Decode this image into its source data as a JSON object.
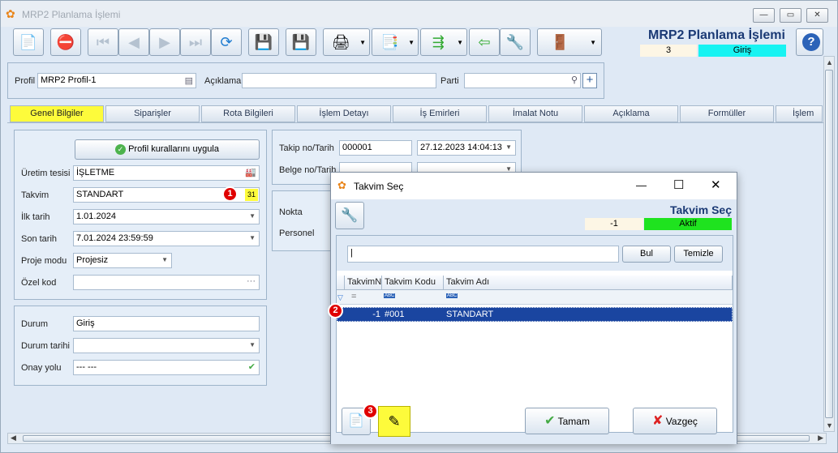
{
  "window": {
    "title": "MRP2 Planlama İşlemi",
    "icon": "butterfly-icon"
  },
  "header": {
    "title": "MRP2 Planlama İşlemi",
    "number": "3",
    "mode": "Giriş",
    "mode_color": "#17f3f2"
  },
  "filter": {
    "profil_label": "Profil",
    "profil_value": "MRP2 Profil-1",
    "aciklama_label": "Açıklama",
    "aciklama_value": "",
    "parti_label": "Parti",
    "parti_value": ""
  },
  "tabs": [
    "Genel Bilgiler",
    "Siparişler",
    "Rota Bilgileri",
    "İşlem Detayı",
    "İş Emirleri",
    "İmalat Notu",
    "Açıklama",
    "Formüller",
    "İşlem G"
  ],
  "left_panel": {
    "apply_button": "Profil kurallarını uygula",
    "uretim_label": "Üretim tesisi",
    "uretim_value": "İŞLETME",
    "takvim_label": "Takvim",
    "takvim_value": "STANDART",
    "ilk_label": "İlk tarih",
    "ilk_value": "1.01.2024",
    "son_label": "Son tarih",
    "son_value": "7.01.2024 23:59:59",
    "proje_label": "Proje modu",
    "proje_value": "Projesiz",
    "ozel_label": "Özel kod",
    "ozel_value": "",
    "ozel_button": "···"
  },
  "status_panel": {
    "durum_label": "Durum",
    "durum_value": "Giriş",
    "durum_tarihi_label": "Durum tarihi",
    "durum_tarihi_value": "",
    "onay_label": "Onay yolu",
    "onay_value": "--- ---"
  },
  "right_panel": {
    "takip_label": "Takip no/Tarih",
    "takip_no": "000001",
    "takip_tarih": "27.12.2023 14:04:13",
    "belge_label": "Belge no/Tarih",
    "nokta_label": "Nokta",
    "personel_label": "Personel"
  },
  "dialog": {
    "title": "Takvim Seç",
    "header_title": "Takvim Seç",
    "header_number": "-1",
    "header_status": "Aktif",
    "status_color": "#1fe31f",
    "search_value": "",
    "bul_button": "Bul",
    "temizle_button": "Temizle",
    "columns": [
      "TakvimN",
      "Takvim Kodu",
      "Takvim Adı"
    ],
    "filter_equals": "=",
    "filter_abc": "ABC",
    "rows": [
      {
        "no": "-1",
        "kod": "#001",
        "ad": "STANDART"
      }
    ],
    "tamam_button": "Tamam",
    "vazgec_button": "Vazgeç"
  },
  "markers": [
    "1",
    "2",
    "3"
  ]
}
